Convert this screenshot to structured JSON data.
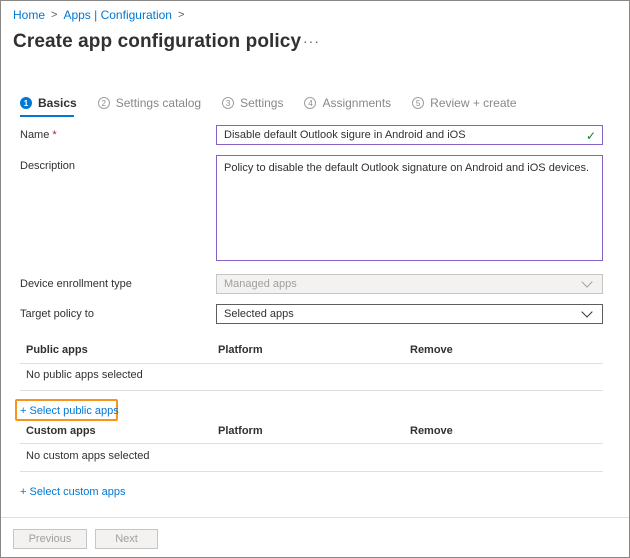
{
  "breadcrumb": {
    "home": "Home",
    "apps_config": "Apps | Configuration",
    "sep": ">"
  },
  "page": {
    "title": "Create app configuration policy",
    "more": "···"
  },
  "steps": [
    {
      "num": "1",
      "label": "Basics"
    },
    {
      "num": "2",
      "label": "Settings catalog"
    },
    {
      "num": "3",
      "label": "Settings"
    },
    {
      "num": "4",
      "label": "Assignments"
    },
    {
      "num": "5",
      "label": "Review + create"
    }
  ],
  "form": {
    "name_label": "Name",
    "required_mark": "*",
    "name_value": "Disable default Outlook sigure in Android and iOS",
    "description_label": "Description",
    "description_value": "Policy to disable the default Outlook signature on Android and iOS devices.",
    "enrollment_label": "Device enrollment type",
    "enrollment_value": "Managed apps",
    "target_label": "Target policy to",
    "target_value": "Selected apps"
  },
  "public_apps": {
    "col_app": "Public apps",
    "col_platform": "Platform",
    "col_remove": "Remove",
    "empty": "No public apps selected",
    "add_link": "+ Select public apps"
  },
  "custom_apps": {
    "col_app": "Custom apps",
    "col_platform": "Platform",
    "col_remove": "Remove",
    "empty": "No custom apps selected",
    "add_link": "+ Select custom apps"
  },
  "footer": {
    "previous": "Previous",
    "next": "Next"
  },
  "colors": {
    "accent": "#0078d4",
    "valid_border": "#8661c5",
    "highlight": "#f7941d",
    "success": "#107c10"
  }
}
